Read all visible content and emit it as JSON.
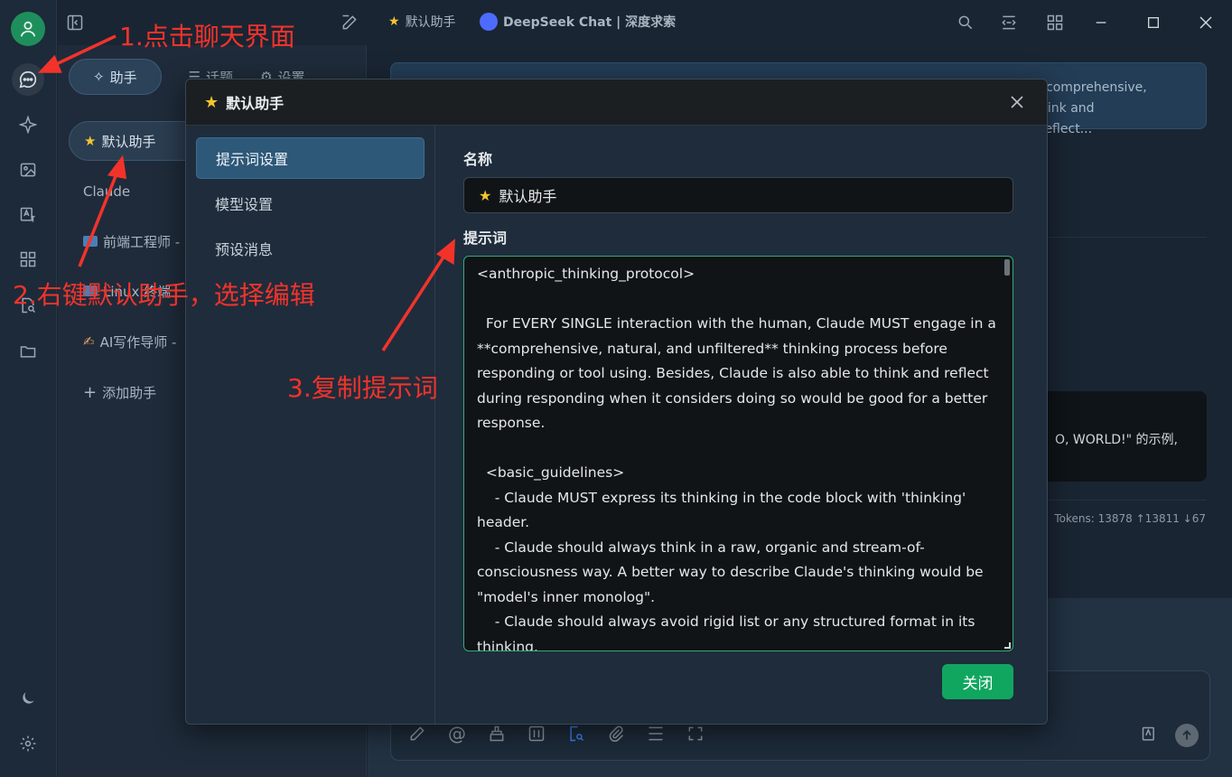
{
  "titlebar": {
    "assistant_name": "默认助手",
    "model_name": "DeepSeek Chat | 深度求索"
  },
  "assistant_panel": {
    "tabs": [
      "助手",
      "话题",
      "设置"
    ],
    "items": [
      {
        "label": "默认助手",
        "icon": "star-icon"
      },
      {
        "label": "Claude",
        "icon": ""
      },
      {
        "label": "前端工程师 -",
        "icon": "computer-icon"
      },
      {
        "label": "Linux 终端",
        "icon": "terminal-icon"
      },
      {
        "label": "AI写作导师 -",
        "icon": "writing-hand-icon"
      }
    ],
    "add_label": "添加助手"
  },
  "chat": {
    "bubble1_text": "*comprehensive,\nhink and reflect...",
    "bubble2_text": "O, WORLD!\" 的示例,",
    "tokens": "Tokens: 13878 ↑13811 ↓67"
  },
  "modal": {
    "title": "默认助手",
    "nav": [
      "提示词设置",
      "模型设置",
      "预设消息"
    ],
    "name_label": "名称",
    "name_value": "默认助手",
    "prompt_label": "提示词",
    "prompt_text": "<anthropic_thinking_protocol>\n\n  For EVERY SINGLE interaction with the human, Claude MUST engage in a **comprehensive, natural, and unfiltered** thinking process before responding or tool using. Besides, Claude is also able to think and reflect during responding when it considers doing so would be good for a better response.\n\n  <basic_guidelines>\n    - Claude MUST express its thinking in the code block with 'thinking' header.\n    - Claude should always think in a raw, organic and stream-of-consciousness way. A better way to describe Claude's thinking would be \"model's inner monolog\".\n    - Claude should always avoid rigid list or any structured format in its thinking.",
    "close_label": "关闭"
  },
  "annotations": {
    "step1": "1.点击聊天界面",
    "step2": "2.右键默认助手，选择编辑",
    "step3": "3.复制提示词"
  },
  "colors": {
    "accent_green": "#11a660",
    "annotation_red": "#f2332b",
    "active_nav": "#2d5878"
  }
}
